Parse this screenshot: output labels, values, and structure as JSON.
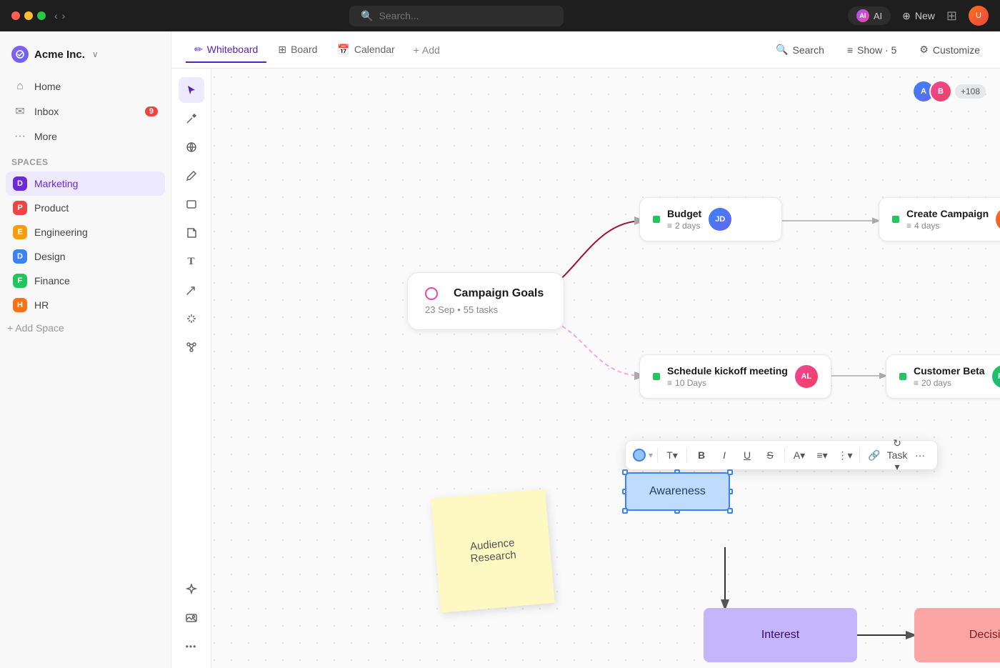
{
  "app": {
    "title": "Acme Inc.",
    "brand": "Acme Inc.",
    "search_placeholder": "Search...",
    "ai_label": "AI"
  },
  "titlebar": {
    "new_label": "New",
    "grid_icon": "⊞",
    "users_count": "+108"
  },
  "tabs": {
    "whiteboard_label": "Whiteboard",
    "board_label": "Board",
    "calendar_label": "Calendar",
    "add_label": "Add",
    "search_label": "Search",
    "show_label": "Show · 5",
    "customize_label": "Customize"
  },
  "sidebar": {
    "home_label": "Home",
    "inbox_label": "Inbox",
    "inbox_badge": "9",
    "more_label": "More",
    "spaces_label": "Spaces",
    "spaces": [
      {
        "id": "marketing",
        "label": "Marketing",
        "letter": "D",
        "color": "dot-marketing",
        "active": true
      },
      {
        "id": "product",
        "label": "Product",
        "letter": "P",
        "color": "dot-product",
        "active": false
      },
      {
        "id": "engineering",
        "label": "Engineering",
        "letter": "E",
        "color": "dot-engineering",
        "active": false
      },
      {
        "id": "design",
        "label": "Design",
        "letter": "D",
        "color": "dot-design",
        "active": false
      },
      {
        "id": "finance",
        "label": "Finance",
        "letter": "F",
        "color": "dot-finance",
        "active": false
      },
      {
        "id": "hr",
        "label": "HR",
        "letter": "H",
        "color": "dot-hr",
        "active": false
      }
    ],
    "add_space_label": "+ Add Space"
  },
  "whiteboard": {
    "nodes": {
      "budget": {
        "title": "Budget",
        "meta": "2 days"
      },
      "create_campaign": {
        "title": "Create Campaign",
        "meta": "4 days"
      },
      "campaign_goals": {
        "title": "Campaign Goals",
        "date": "23 Sep",
        "tasks": "55 tasks"
      },
      "schedule_kickoff": {
        "title": "Schedule kickoff meeting",
        "meta": "10 Days"
      },
      "customer_beta": {
        "title": "Customer Beta",
        "meta": "20 days"
      }
    },
    "sticky": {
      "text": "Audience Research"
    },
    "awareness_label": "Awareness",
    "interest_label": "Interest",
    "decision_label": "Decision"
  },
  "toolbar": {
    "tools": [
      "cursor",
      "paint",
      "globe",
      "pen",
      "rect",
      "note",
      "text",
      "arrow",
      "share",
      "sparkle",
      "image",
      "more"
    ]
  }
}
